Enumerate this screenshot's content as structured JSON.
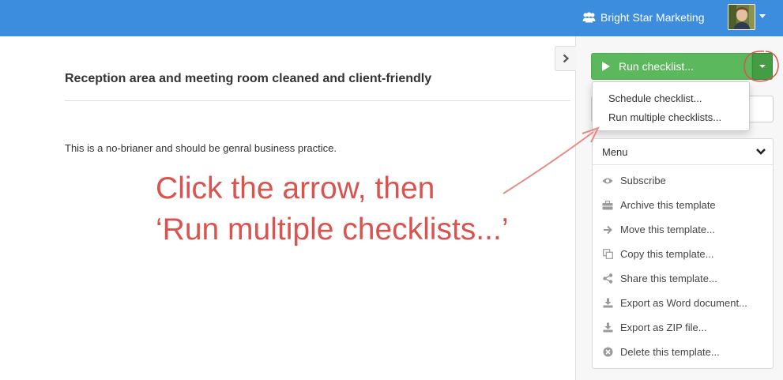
{
  "header": {
    "org_name": "Bright Star Marketing",
    "org_icon": "users-icon",
    "background": "#3c8dde"
  },
  "content": {
    "title": "Reception area and meeting room cleaned and client-friendly",
    "body": "This is a no-brianer and should be genral business practice."
  },
  "sidebar": {
    "run_button_label": "Run checklist...",
    "run_button_color": "#5cb85c",
    "dropdown_items": [
      {
        "label": "Schedule checklist..."
      },
      {
        "label": "Run multiple checklists..."
      }
    ],
    "menu": {
      "title": "Menu",
      "items": [
        {
          "label": "Subscribe",
          "icon": "eye-icon"
        },
        {
          "label": "Archive this template",
          "icon": "briefcase-icon"
        },
        {
          "label": "Move this template...",
          "icon": "arrow-right-icon"
        },
        {
          "label": "Copy this template...",
          "icon": "copy-icon"
        },
        {
          "label": "Share this template...",
          "icon": "share-icon"
        },
        {
          "label": "Export as Word document...",
          "icon": "download-icon"
        },
        {
          "label": "Export as ZIP file...",
          "icon": "download-icon"
        },
        {
          "label": "Delete this template...",
          "icon": "delete-icon"
        }
      ]
    }
  },
  "annotation": {
    "line1": "Click the arrow, then",
    "line2": "‘Run multiple checklists...’",
    "color": "#d9534f"
  }
}
